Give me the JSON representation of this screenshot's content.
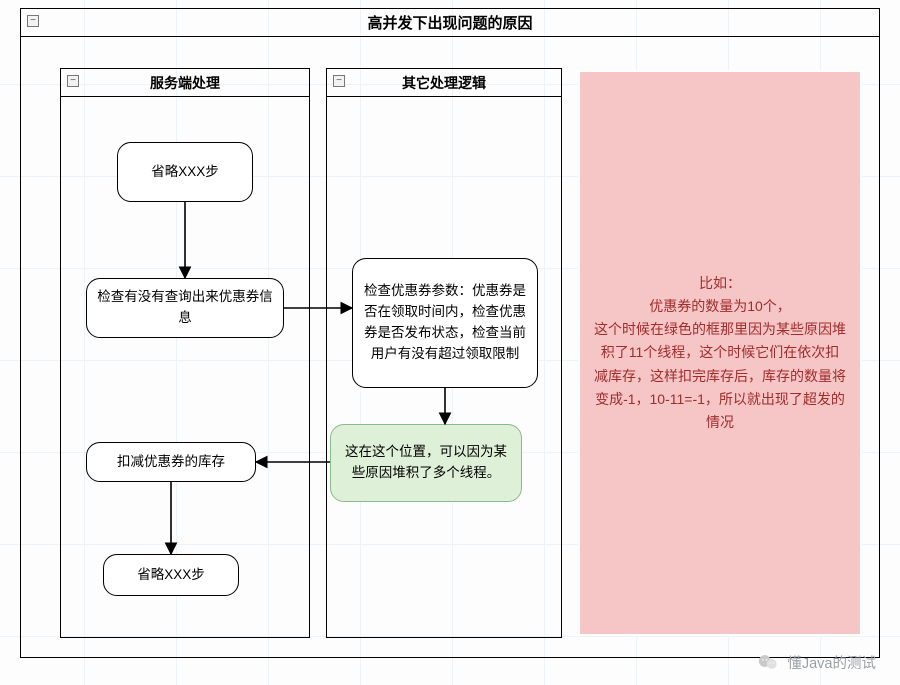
{
  "container": {
    "title": "高并发下出现问题的原因",
    "collapse_glyph": "−"
  },
  "lanes": {
    "server": {
      "title": "服务端处理",
      "collapse_glyph": "−"
    },
    "other": {
      "title": "其它处理逻辑",
      "collapse_glyph": "−"
    }
  },
  "nodes": {
    "skip1": "省略XXX步",
    "check_coupon_info": "检查有没有查询出来优惠券信息",
    "check_params": "检查优惠券参数：优惠券是否在领取时间内，检查优惠券是否发布状态，检查当前用户有没有超过领取限制",
    "deduct_stock": "扣减优惠券的库存",
    "green_note": "这在这个位置，可以因为某些原因堆积了多个线程。",
    "skip2": "省略XXX步"
  },
  "note": {
    "text_lines": [
      "比如：",
      "优惠券的数量为10个，",
      "这个时候在绿色的框那里因为某些原因堆积了11个线程，这个时候它们在依次扣减库存，这样扣完库存后，库存的数量将变成-1，10-11=-1，所以就出现了超发的情况"
    ]
  },
  "watermark": {
    "text": "懂Java的测试"
  },
  "colors": {
    "node_green_bg": "#dff0d8",
    "note_bg": "#f6c6c6",
    "note_fg": "#a02c2c"
  }
}
